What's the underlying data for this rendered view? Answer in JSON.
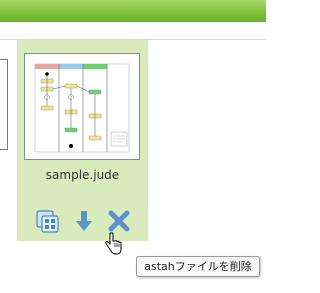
{
  "file": {
    "name": "sample.jude",
    "thumbnail_icon": "activity-diagram-thumbnail"
  },
  "actions": [
    {
      "name": "open-icon"
    },
    {
      "name": "download-arrow-icon"
    },
    {
      "name": "delete-x-icon"
    }
  ],
  "tooltip": {
    "text": "astahファイルを削除"
  },
  "colors": {
    "top_bar": "#7fc23c",
    "card_bg": "#d9ebbd",
    "icon_blue": "#4a86c4"
  }
}
